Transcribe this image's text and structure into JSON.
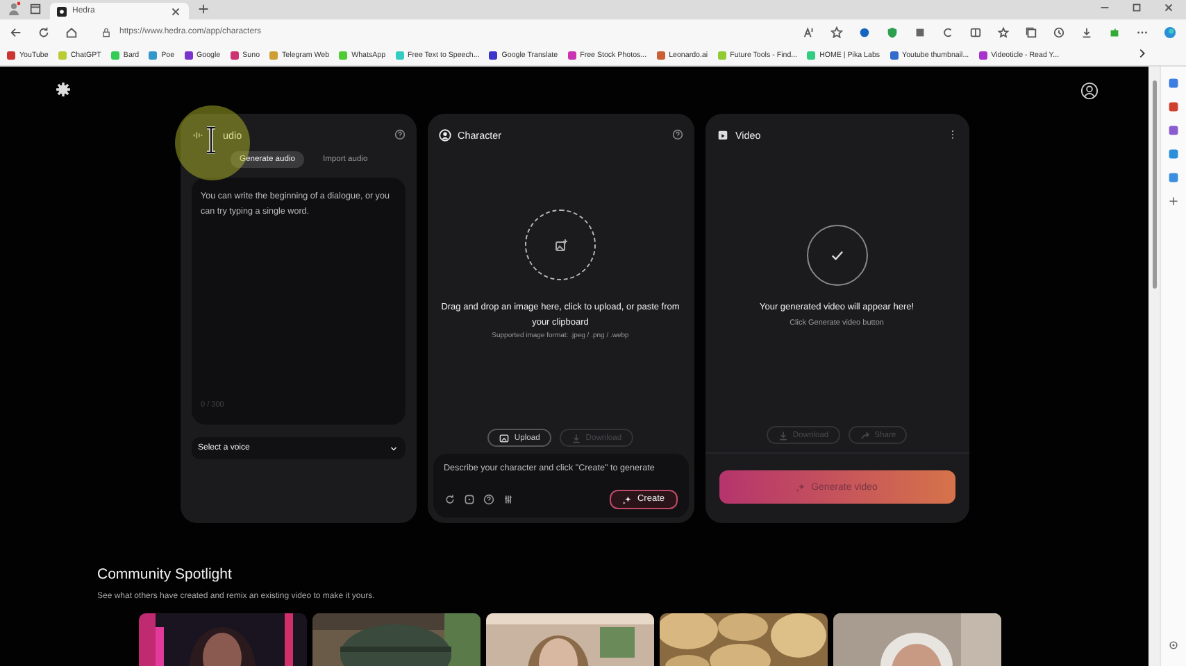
{
  "browser": {
    "tab_title": "Hedra",
    "url": "https://www.hedra.com/app/characters",
    "bookmarks": [
      "YouTube",
      "ChatGPT",
      "Bard",
      "Poe",
      "Google",
      "Suno",
      "Telegram Web",
      "WhatsApp",
      "Free Text to Speech...",
      "Google Translate",
      "Free Stock Photos...",
      "Leonardo.ai",
      "Future Tools - Find...",
      "HOME | Pika Labs",
      "Youtube thumbnail...",
      "Videoticle - Read Y..."
    ]
  },
  "audio_panel": {
    "title": "udio",
    "tabs": [
      {
        "label": "Generate audio",
        "selected": true
      },
      {
        "label": "Import audio",
        "selected": false
      }
    ],
    "placeholder": "You can write the beginning of a dialogue, or you can try typing a single word.",
    "counter": "0 / 300",
    "voice_select": "Select a voice"
  },
  "character_panel": {
    "title": "Character",
    "drop_text": "Drag and drop an image here, click to upload, or paste from your clipboard",
    "formats": "Supported image format: .jpeg / .png / .webp",
    "buttons": [
      {
        "label": "Upload",
        "disabled": false
      },
      {
        "label": "Download",
        "disabled": true
      }
    ],
    "prompt_placeholder": "Describe your character and click \"Create\" to generate",
    "create_button": "Create"
  },
  "video_panel": {
    "title": "Video",
    "message": "Your generated video will appear here!",
    "hint": "Click Generate video button",
    "buttons": [
      {
        "label": "Download",
        "disabled": true
      },
      {
        "label": "Share",
        "disabled": true
      }
    ],
    "generate_button": "Generate video"
  },
  "spotlight": {
    "title": "Community Spotlight",
    "subtitle": "See what others have created and remix an existing video to make it yours."
  }
}
